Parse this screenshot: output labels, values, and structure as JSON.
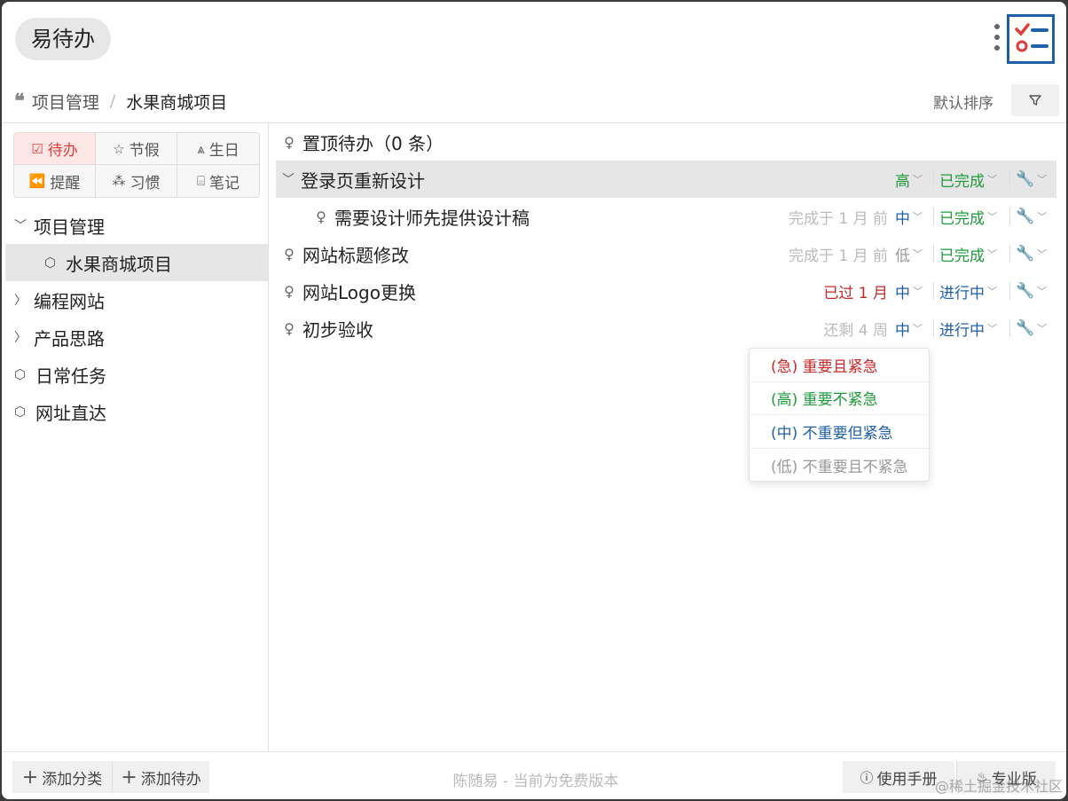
{
  "app": {
    "title": "易待办",
    "accent_color": "#e03b3b",
    "logo_color": "#1f5fa8"
  },
  "breadcrumb": {
    "items": [
      "项目管理",
      "水果商城项目"
    ],
    "separator": "/"
  },
  "toolbar": {
    "sort_label": "默认排序",
    "filter_icon": "filter-icon"
  },
  "categories": [
    {
      "label": "待办",
      "icon": "checkbox-icon",
      "glyph": "☑",
      "active": true
    },
    {
      "label": "节假",
      "icon": "star-icon",
      "glyph": "☆",
      "active": false
    },
    {
      "label": "生日",
      "icon": "person-icon",
      "glyph": "⩓",
      "active": false
    },
    {
      "label": "提醒",
      "icon": "rewind-icon",
      "glyph": "⏪",
      "active": false
    },
    {
      "label": "习惯",
      "icon": "habit-icon",
      "glyph": "⁂",
      "active": false
    },
    {
      "label": "笔记",
      "icon": "note-icon",
      "glyph": "⌸",
      "active": false
    }
  ],
  "tree": [
    {
      "label": "项目管理",
      "type": "folder",
      "expanded": true
    },
    {
      "label": "水果商城项目",
      "type": "project",
      "selected": true
    },
    {
      "label": "编程网站",
      "type": "folder",
      "expanded": false
    },
    {
      "label": "产品思路",
      "type": "folder",
      "expanded": false
    },
    {
      "label": "日常任务",
      "type": "project"
    },
    {
      "label": "网址直达",
      "type": "project"
    }
  ],
  "pinned": {
    "label": "置顶待办（0 条）"
  },
  "tasks": [
    {
      "title": "登录页重新设计",
      "time": "",
      "priority": "高",
      "status": "已完成",
      "group": true
    },
    {
      "title": "需要设计师先提供设计稿",
      "time": "完成于 1 月 前",
      "priority": "中",
      "status": "已完成",
      "sub": true
    },
    {
      "title": "网站标题修改",
      "time": "完成于 1 月 前",
      "priority": "低",
      "status": "已完成"
    },
    {
      "title": "网站Logo更换",
      "time": "已过  1 月",
      "priority": "中",
      "status": "进行中",
      "overdue": true
    },
    {
      "title": "初步验收",
      "time": "还剩  4 周",
      "priority": "中",
      "status": "进行中"
    }
  ],
  "priority_menu": [
    {
      "label": "(急) 重要且紧急",
      "level": "urgent"
    },
    {
      "label": "(高) 重要不紧急",
      "level": "high"
    },
    {
      "label": "(中) 不重要但紧急",
      "level": "mid"
    },
    {
      "label": "(低) 不重要且不紧急",
      "level": "low"
    }
  ],
  "footer": {
    "add_category": "添加分类",
    "add_todo": "添加待办",
    "note": "陈随易 - 当前为免费版本",
    "manual": "使用手册",
    "pro": "专业版",
    "watermark": "@稀土掘金技术社区"
  }
}
